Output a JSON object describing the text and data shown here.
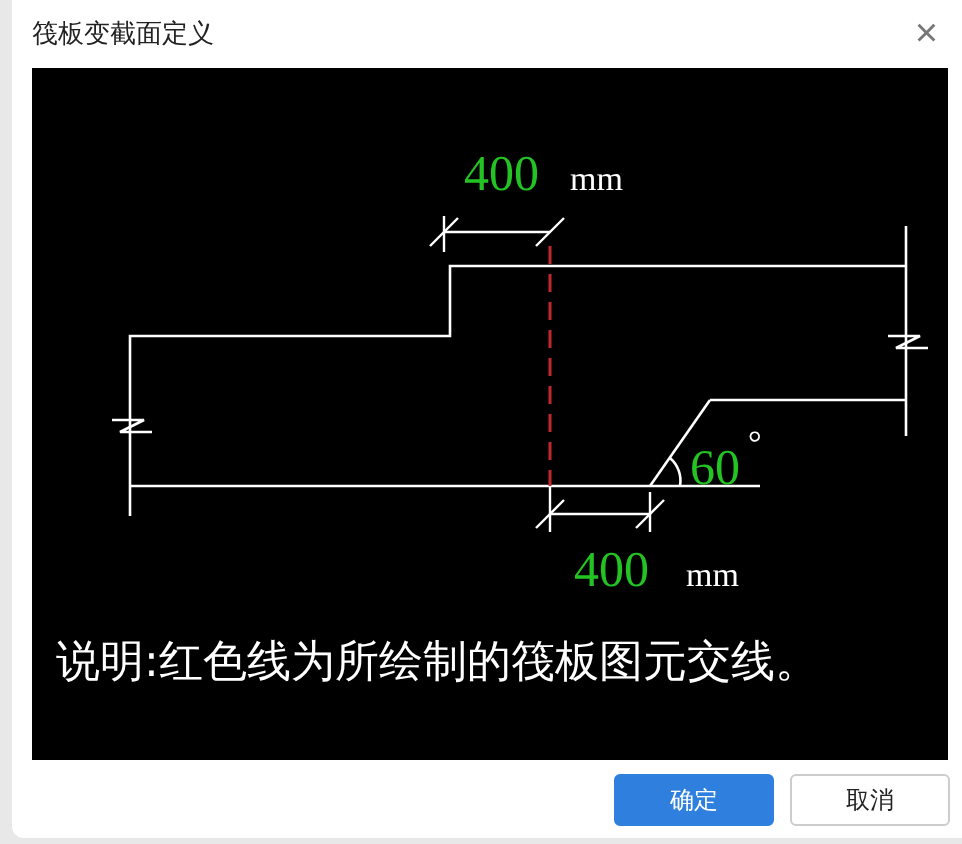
{
  "window": {
    "title": "筏板变截面定义",
    "close": "×"
  },
  "diagram": {
    "top_dimension": {
      "value": "400",
      "unit": "mm"
    },
    "bottom_dimension": {
      "value": "400",
      "unit": "mm"
    },
    "angle": {
      "value": "60",
      "unit": "°"
    },
    "note": "说明:红色线为所绘制的筏板图元交线。"
  },
  "buttons": [
    {
      "label": "确定",
      "kind": "primary"
    },
    {
      "label": "取消",
      "kind": "secondary"
    }
  ]
}
